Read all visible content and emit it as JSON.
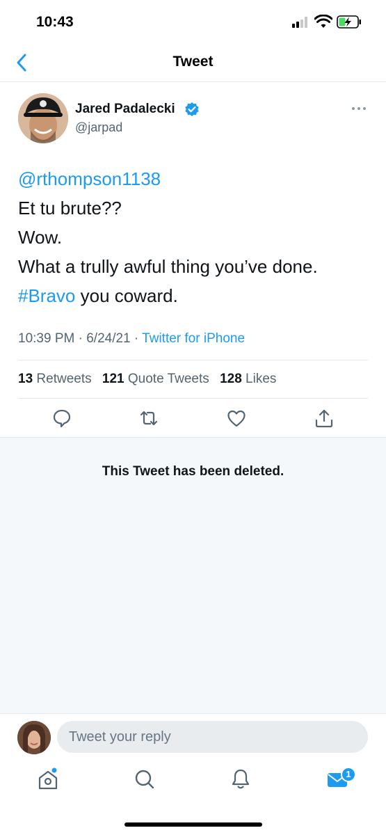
{
  "status_bar": {
    "time": "10:43"
  },
  "nav": {
    "title": "Tweet",
    "back_icon": "chevron-left-icon"
  },
  "tweet": {
    "author_name": "Jared Padalecki",
    "author_handle": "@jarpad",
    "verified": true,
    "mention": "@rthompson1138",
    "line1": "Et tu brute??",
    "line2": "Wow.",
    "line3": "What a trully awful thing you’ve done.",
    "hashtag": "#Bravo",
    "line4_rest": " you coward.",
    "time": "10:39 PM",
    "date": "6/24/21",
    "source": "Twitter for iPhone",
    "separator": "·"
  },
  "stats": {
    "retweets_count": "13",
    "retweets_label": "Retweets",
    "quotes_count": "121",
    "quotes_label": "Quote Tweets",
    "likes_count": "128",
    "likes_label": "Likes"
  },
  "deleted": {
    "message": "This Tweet has been deleted."
  },
  "reply": {
    "placeholder": "Tweet your reply"
  },
  "tab_bar": {
    "messages_badge": "1"
  },
  "colors": {
    "accent": "#1d9bf0",
    "text": "#0f1419",
    "secondary": "#536471",
    "battery_green": "#4cd964"
  }
}
